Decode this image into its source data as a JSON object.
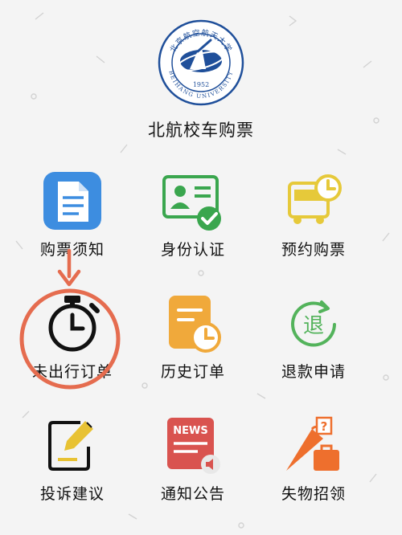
{
  "page": {
    "title": "北航校车购票"
  },
  "logo": {
    "top_text": "北京航空航天大学",
    "bottom_text": "BEIHANG UNIVERSITY",
    "year": "1952"
  },
  "menu": {
    "items": [
      {
        "label": "购票须知",
        "icon": "document-icon",
        "color": "#3d8de0"
      },
      {
        "label": "身份认证",
        "icon": "id-card-check-icon",
        "color": "#3aa64e"
      },
      {
        "label": "预约购票",
        "icon": "bus-clock-icon",
        "color": "#e6c93a"
      },
      {
        "label": "未出行订单",
        "icon": "stopwatch-icon",
        "color": "#111111"
      },
      {
        "label": "历史订单",
        "icon": "clipboard-clock-icon",
        "color": "#f0a93b"
      },
      {
        "label": "退款申请",
        "icon": "refund-icon",
        "color": "#53b35b",
        "glyph": "退"
      },
      {
        "label": "投诉建议",
        "icon": "pencil-note-icon",
        "color": "#e8c233"
      },
      {
        "label": "通知公告",
        "icon": "news-icon",
        "color": "#d9534f",
        "badge": "NEWS"
      },
      {
        "label": "失物招领",
        "icon": "lost-found-icon",
        "color": "#ee6f2d",
        "glyph": "?"
      }
    ]
  },
  "annotation": {
    "color": "#e56c4f",
    "highlighted": "未出行订单"
  }
}
